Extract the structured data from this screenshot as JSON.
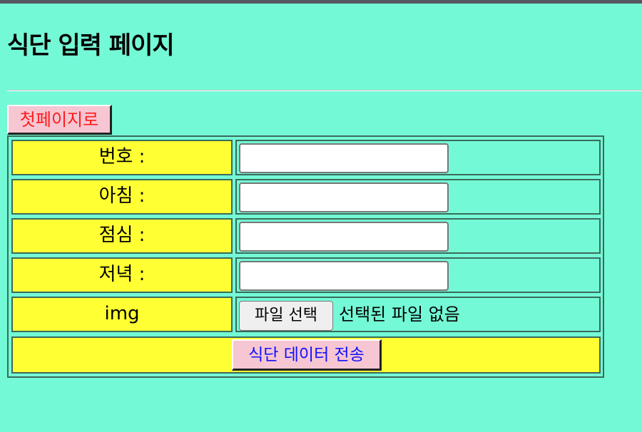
{
  "page": {
    "title": "식단 입력 페이지"
  },
  "nav": {
    "back_label": "첫페이지로"
  },
  "form": {
    "fields": [
      {
        "label": "번호 :",
        "value": ""
      },
      {
        "label": "아침 :",
        "value": ""
      },
      {
        "label": "점심 :",
        "value": ""
      },
      {
        "label": "저녁 :",
        "value": ""
      }
    ],
    "image": {
      "label": "img",
      "button_label": "파일 선택",
      "status": "선택된 파일 없음"
    },
    "submit_label": "식단 데이터 전송"
  },
  "colors": {
    "background": "#74f9d6",
    "label_cell": "#ffff33",
    "button_bg": "#f6c6d2",
    "back_text": "#ff1a1a",
    "submit_text": "#1010ff"
  }
}
